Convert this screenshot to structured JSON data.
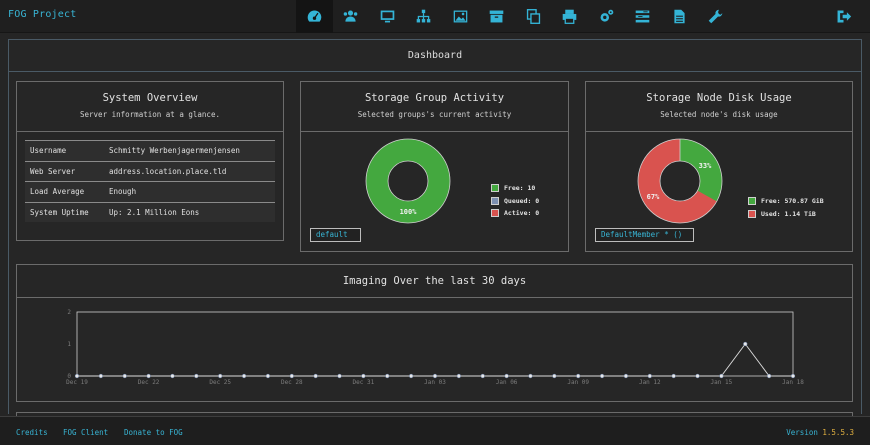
{
  "brand": "FOG Project",
  "nav": [
    {
      "name": "dashboard-icon",
      "label": "Dashboard"
    },
    {
      "name": "users-icon",
      "label": "Users"
    },
    {
      "name": "hosts-icon",
      "label": "Hosts"
    },
    {
      "name": "groups-icon",
      "label": "Groups"
    },
    {
      "name": "images-icon",
      "label": "Images"
    },
    {
      "name": "storage-icon",
      "label": "Storage"
    },
    {
      "name": "snapins-icon",
      "label": "Snapins"
    },
    {
      "name": "printers-icon",
      "label": "Printers"
    },
    {
      "name": "service-icon",
      "label": "Service"
    },
    {
      "name": "tasks-icon",
      "label": "Tasks"
    },
    {
      "name": "reports-icon",
      "label": "Reports"
    },
    {
      "name": "settings-icon",
      "label": "Settings"
    }
  ],
  "page_title": "Dashboard",
  "overview": {
    "title": "System Overview",
    "subtitle": "Server information at a glance.",
    "rows": [
      {
        "k": "Username",
        "v": "Schmitty Werbenjagermenjensen"
      },
      {
        "k": "Web Server",
        "v": "address.location.place.tld"
      },
      {
        "k": "Load Average",
        "v": "Enough"
      },
      {
        "k": "System Uptime",
        "v": "Up: 2.1 Million Eons"
      }
    ]
  },
  "activity": {
    "title": "Storage Group Activity",
    "subtitle": "Selected groups's current activity",
    "slice_label": "100%",
    "legend": [
      {
        "label": "Free: 10",
        "color": "#44a83f"
      },
      {
        "label": "Queued: 0",
        "color": "#7c8fb0"
      },
      {
        "label": "Active: 0",
        "color": "#d9534f"
      }
    ],
    "values": {
      "free": 10,
      "queued": 0,
      "active": 0
    },
    "select": "default"
  },
  "disk": {
    "title": "Storage Node Disk Usage",
    "subtitle": "Selected node's disk usage",
    "free_pct_label": "33%",
    "used_pct_label": "67%",
    "free_fraction": 0.33,
    "legend": [
      {
        "label": "Free: 570.87 GiB",
        "color": "#44a83f"
      },
      {
        "label": "Used: 1.14 TiB",
        "color": "#d9534f"
      }
    ],
    "select": "DefaultMember * ()"
  },
  "imaging": {
    "title": "Imaging Over the last 30 days"
  },
  "chart_data": {
    "type": "line",
    "title": "Imaging Over the last 30 days",
    "ylim": [
      0,
      2
    ],
    "yticks": [
      "0",
      "1",
      "2"
    ],
    "xticks": [
      "Dec 19",
      "Dec 22",
      "Dec 25",
      "Dec 28",
      "Dec 31",
      "Jan 03",
      "Jan 06",
      "Jan 09",
      "Jan 12",
      "Jan 15",
      "Jan 18"
    ],
    "x": [
      "Dec 19",
      "Dec 20",
      "Dec 21",
      "Dec 22",
      "Dec 23",
      "Dec 24",
      "Dec 25",
      "Dec 26",
      "Dec 27",
      "Dec 28",
      "Dec 29",
      "Dec 30",
      "Dec 31",
      "Jan 01",
      "Jan 02",
      "Jan 03",
      "Jan 04",
      "Jan 05",
      "Jan 06",
      "Jan 07",
      "Jan 08",
      "Jan 09",
      "Jan 10",
      "Jan 11",
      "Jan 12",
      "Jan 13",
      "Jan 14",
      "Jan 15",
      "Jan 16",
      "Jan 17",
      "Jan 18"
    ],
    "values": [
      0,
      0,
      0,
      0,
      0,
      0,
      0,
      0,
      0,
      0,
      0,
      0,
      0,
      0,
      0,
      0,
      0,
      0,
      0,
      0,
      0,
      0,
      0,
      0,
      0,
      0,
      0,
      0,
      1,
      0,
      0
    ],
    "grid": false
  },
  "footer": {
    "links": [
      "Credits",
      "FOG Client",
      "Donate to FOG"
    ],
    "version_label": "Version",
    "version": "1.5.5.3"
  },
  "colors": {
    "accent": "#38b4d4",
    "free": "#44a83f",
    "used": "#d9534f",
    "queued": "#7c8fb0"
  }
}
